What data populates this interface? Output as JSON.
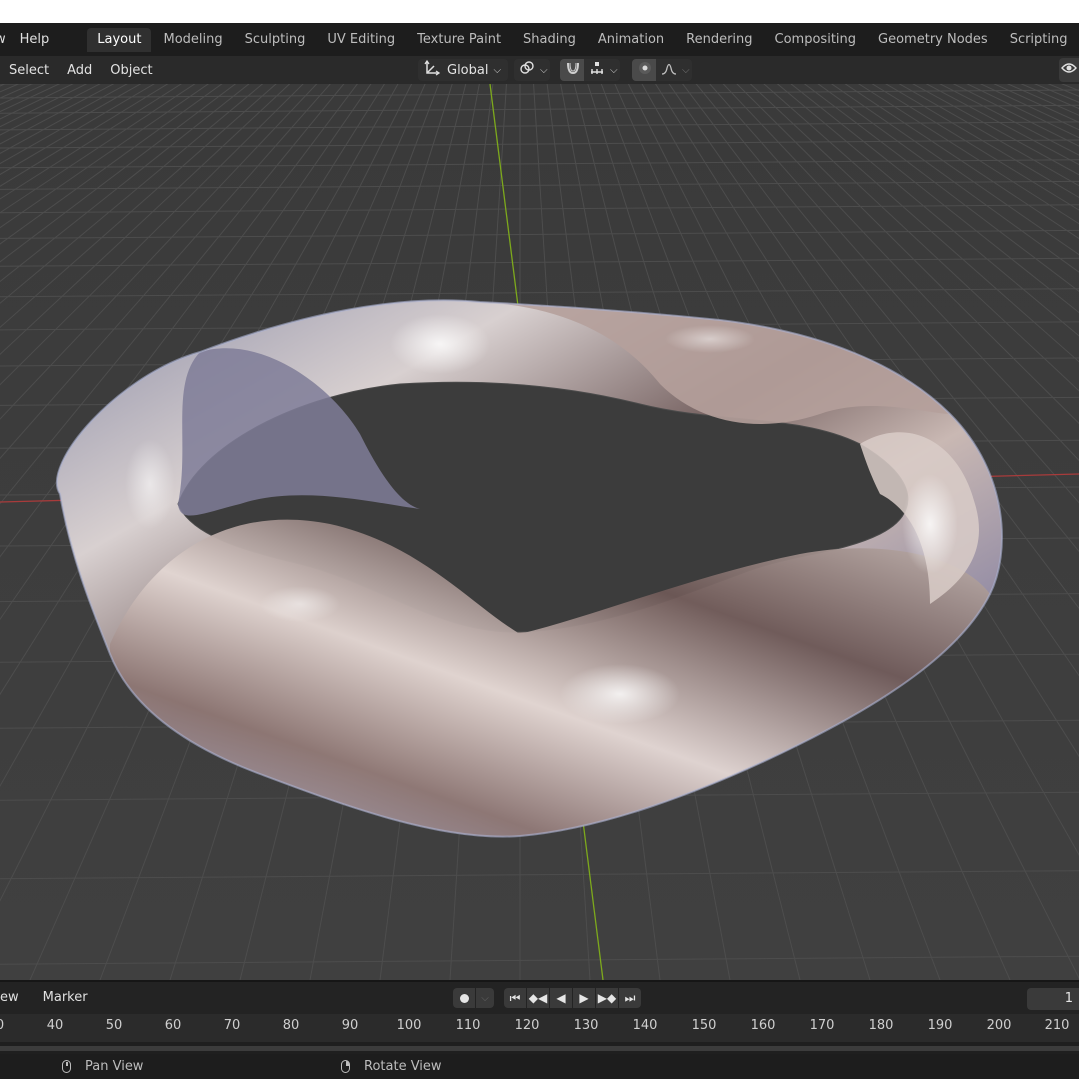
{
  "topbar": {
    "menu_view_stub": "w",
    "menu_help": "Help",
    "tabs": [
      {
        "label": "Layout",
        "active": true
      },
      {
        "label": "Modeling"
      },
      {
        "label": "Sculpting"
      },
      {
        "label": "UV Editing"
      },
      {
        "label": "Texture Paint"
      },
      {
        "label": "Shading"
      },
      {
        "label": "Animation"
      },
      {
        "label": "Rendering"
      },
      {
        "label": "Compositing"
      },
      {
        "label": "Geometry Nodes"
      },
      {
        "label": "Scripting"
      }
    ],
    "add_tab": "+"
  },
  "viewport_header": {
    "select": "Select",
    "add": "Add",
    "object": "Object",
    "transform_orientation": "Global",
    "icons": [
      "transform-orientation-icon",
      "pivot-link-icon",
      "snap-magnet-icon",
      "snap-increment-icon",
      "proportional-edit-icon",
      "falloff-curve-icon",
      "visibility-eye-icon"
    ]
  },
  "viewport": {
    "background_color": "#3d3d3d",
    "grid_color": "#4f4f4f",
    "x_axis_color": "#b83a3a",
    "y_axis_color": "#8bb31f",
    "object": "twisted metallic ring (Möbius-like band)"
  },
  "timeline": {
    "view_stub": "ew",
    "marker": "Marker",
    "current_frame": "1",
    "ticks": [
      "0",
      "40",
      "50",
      "60",
      "70",
      "80",
      "90",
      "100",
      "110",
      "120",
      "130",
      "140",
      "150",
      "160",
      "170",
      "180",
      "190",
      "200",
      "210"
    ]
  },
  "statusbar": {
    "pan_view": "Pan View",
    "rotate_view": "Rotate View"
  }
}
